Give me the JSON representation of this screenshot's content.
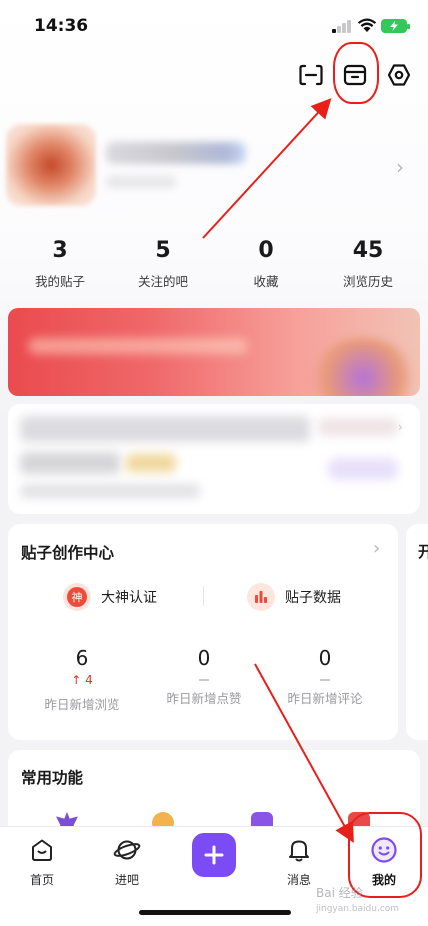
{
  "status_bar": {
    "time": "14:36"
  },
  "header_icons": [
    "scan-icon",
    "box-icon",
    "settings-icon"
  ],
  "profile": {
    "name": "",
    "subtitle": ""
  },
  "stats": [
    {
      "value": "3",
      "label": "我的贴子"
    },
    {
      "value": "5",
      "label": "关注的吧"
    },
    {
      "value": "0",
      "label": "收藏"
    },
    {
      "value": "45",
      "label": "浏览历史"
    }
  ],
  "creation_center": {
    "title": "贴子创作中心",
    "features": [
      {
        "label": "大神认证",
        "icon_text": "神"
      },
      {
        "label": "贴子数据"
      }
    ],
    "metrics": [
      {
        "value": "6",
        "delta": "4",
        "label": "昨日新增浏览"
      },
      {
        "value": "0",
        "label": "昨日新增点赞"
      },
      {
        "value": "0",
        "label": "昨日新增评论"
      }
    ]
  },
  "side_card": {
    "title": "开"
  },
  "common_functions": {
    "title": "常用功能"
  },
  "tabbar": {
    "items": [
      {
        "label": "首页"
      },
      {
        "label": "进吧"
      },
      {
        "label": "消息"
      },
      {
        "label": "我的"
      }
    ]
  },
  "watermark": {
    "line1": "Bai 经验",
    "line2": "jingyan.baidu.com"
  },
  "colors": {
    "accent": "#7b4cf5",
    "annotation": "#e8201a",
    "delta_up": "#e0332b"
  }
}
